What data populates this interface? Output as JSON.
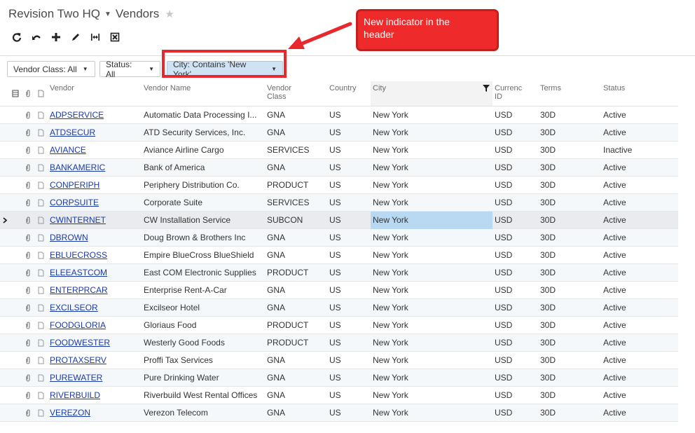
{
  "header": {
    "company": "Revision Two HQ",
    "screen": "Vendors"
  },
  "filters": {
    "vendor_class": "Vendor Class: All",
    "status": "Status: All",
    "city": "City: Contains 'New York'"
  },
  "callout": {
    "line1": "New indicator in the",
    "line2": "header"
  },
  "columns": {
    "vendor": "Vendor",
    "vendor_name": "Vendor Name",
    "vendor_class_1": "Vendor",
    "vendor_class_2": "Class",
    "country": "Country",
    "city": "City",
    "currency_1": "Currenc",
    "currency_2": "ID",
    "terms": "Terms",
    "status": "Status"
  },
  "rows": [
    {
      "vendor": "ADPSERVICE",
      "name": "Automatic Data Processing I...",
      "class": "GNA",
      "country": "US",
      "city": "New York",
      "currency": "USD",
      "terms": "30D",
      "status": "Active"
    },
    {
      "vendor": "ATDSECUR",
      "name": "ATD Security Services, Inc.",
      "class": "GNA",
      "country": "US",
      "city": "New York",
      "currency": "USD",
      "terms": "30D",
      "status": "Active"
    },
    {
      "vendor": "AVIANCE",
      "name": "Aviance Airline Cargo",
      "class": "SERVICES",
      "country": "US",
      "city": "New York",
      "currency": "USD",
      "terms": "30D",
      "status": "Inactive"
    },
    {
      "vendor": "BANKAMERIC",
      "name": "Bank of America",
      "class": "GNA",
      "country": "US",
      "city": "New York",
      "currency": "USD",
      "terms": "30D",
      "status": "Active"
    },
    {
      "vendor": "CONPERIPH",
      "name": "Periphery Distribution Co.",
      "class": "PRODUCT",
      "country": "US",
      "city": "New York",
      "currency": "USD",
      "terms": "30D",
      "status": "Active"
    },
    {
      "vendor": "CORPSUITE",
      "name": "Corporate Suite",
      "class": "SERVICES",
      "country": "US",
      "city": "New York",
      "currency": "USD",
      "terms": "30D",
      "status": "Active"
    },
    {
      "vendor": "CWINTERNET",
      "name": "CW Installation Service",
      "class": "SUBCON",
      "country": "US",
      "city": "New York",
      "currency": "USD",
      "terms": "30D",
      "status": "Active"
    },
    {
      "vendor": "DBROWN",
      "name": "Doug Brown & Brothers Inc",
      "class": "GNA",
      "country": "US",
      "city": "New York",
      "currency": "USD",
      "terms": "30D",
      "status": "Active"
    },
    {
      "vendor": "EBLUECROSS",
      "name": "Empire BlueCross BlueShield",
      "class": "GNA",
      "country": "US",
      "city": "New York",
      "currency": "USD",
      "terms": "30D",
      "status": "Active"
    },
    {
      "vendor": "ELEEASTCOM",
      "name": "East COM Electronic Supplies",
      "class": "PRODUCT",
      "country": "US",
      "city": "New York",
      "currency": "USD",
      "terms": "30D",
      "status": "Active"
    },
    {
      "vendor": "ENTERPRCAR",
      "name": "Enterprise Rent-A-Car",
      "class": "GNA",
      "country": "US",
      "city": "New York",
      "currency": "USD",
      "terms": "30D",
      "status": "Active"
    },
    {
      "vendor": "EXCILSEOR",
      "name": "Excilseor Hotel",
      "class": "GNA",
      "country": "US",
      "city": "New York",
      "currency": "USD",
      "terms": "30D",
      "status": "Active"
    },
    {
      "vendor": "FOODGLORIA",
      "name": "Gloriaus Food",
      "class": "PRODUCT",
      "country": "US",
      "city": "New York",
      "currency": "USD",
      "terms": "30D",
      "status": "Active"
    },
    {
      "vendor": "FOODWESTER",
      "name": "Westerly Good Foods",
      "class": "PRODUCT",
      "country": "US",
      "city": "New York",
      "currency": "USD",
      "terms": "30D",
      "status": "Active"
    },
    {
      "vendor": "PROTAXSERV",
      "name": "Proffi Tax Services",
      "class": "GNA",
      "country": "US",
      "city": "New York",
      "currency": "USD",
      "terms": "30D",
      "status": "Active"
    },
    {
      "vendor": "PUREWATER",
      "name": "Pure Drinking Water",
      "class": "GNA",
      "country": "US",
      "city": "New York",
      "currency": "USD",
      "terms": "30D",
      "status": "Active"
    },
    {
      "vendor": "RIVERBUILD",
      "name": "Riverbuild West Rental Offices",
      "class": "GNA",
      "country": "US",
      "city": "New York",
      "currency": "USD",
      "terms": "30D",
      "status": "Active"
    },
    {
      "vendor": "VEREZON",
      "name": "Verezon Telecom",
      "class": "GNA",
      "country": "US",
      "city": "New York",
      "currency": "USD",
      "terms": "30D",
      "status": "Active"
    }
  ],
  "selected_row": 6,
  "colors": {
    "accent": "#cfe3f5",
    "link": "#1a3aa8",
    "annotation": "#e8282c"
  }
}
